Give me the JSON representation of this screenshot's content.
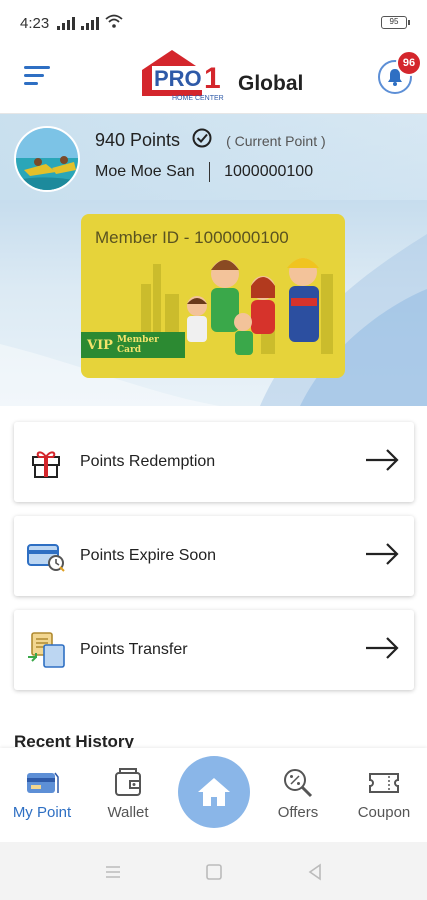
{
  "status": {
    "time": "4:23",
    "battery": "95"
  },
  "header": {
    "logo_pro": "PRO",
    "logo_one": "1",
    "logo_global": "Global",
    "logo_tagline": "HOME CENTER",
    "notification_count": "96"
  },
  "profile": {
    "points": "940 Points",
    "current_point_label": "( Current Point )",
    "name": "Moe Moe San",
    "member_number": "1000000100"
  },
  "member_card": {
    "member_id": "Member ID - 1000000100",
    "vip_label": "VIP",
    "vip_sub": "Member Card"
  },
  "menu": [
    {
      "label": "Points Redemption",
      "icon": "gift-icon"
    },
    {
      "label": "Points Expire Soon",
      "icon": "card-clock-icon"
    },
    {
      "label": "Points Transfer",
      "icon": "transfer-icon"
    }
  ],
  "recent_history_title": "Recent History",
  "tabs": [
    {
      "label": "My Point",
      "icon": "card-icon",
      "active": true
    },
    {
      "label": "Wallet",
      "icon": "wallet-icon",
      "active": false
    },
    {
      "label": "Offers",
      "icon": "search-percent-icon",
      "active": false
    },
    {
      "label": "Coupon",
      "icon": "coupon-icon",
      "active": false
    }
  ],
  "colors": {
    "accent": "#2e6fc3",
    "home_button": "#8ab6e8",
    "badge": "#d4262c",
    "card": "#e6d33a",
    "vip_green": "#2c8a32"
  }
}
